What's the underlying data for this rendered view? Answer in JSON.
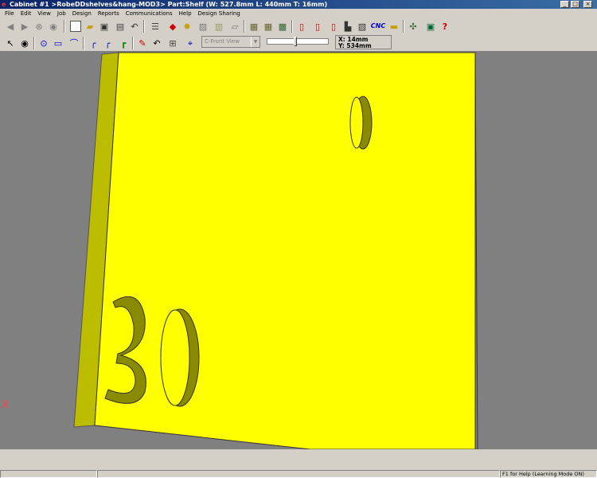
{
  "window": {
    "title": "Cabinet #1 >RobeDDshelves&hang-MOD3> Part:Shelf (W: 527.8mm L: 440mm T: 16mm)",
    "min_label": "_",
    "max_label": "□",
    "close_label": "×"
  },
  "menu": [
    "File",
    "Edit",
    "View",
    "Job",
    "Design",
    "Reports",
    "Communications",
    "Help",
    "Design Sharing"
  ],
  "toolbar": {
    "view_select": "C-Front View",
    "cnc_label": "CNC",
    "help_label": "?"
  },
  "coords": {
    "x": "X:  14mm",
    "y": "Y: 534mm"
  },
  "viewport": {
    "part_color": "#ffff00",
    "edge_color": "#bdbd00",
    "origin_marker": "X",
    "engraved_text": "30"
  },
  "status": {
    "help_text": "F1 for Help (Learning Mode ON)"
  }
}
